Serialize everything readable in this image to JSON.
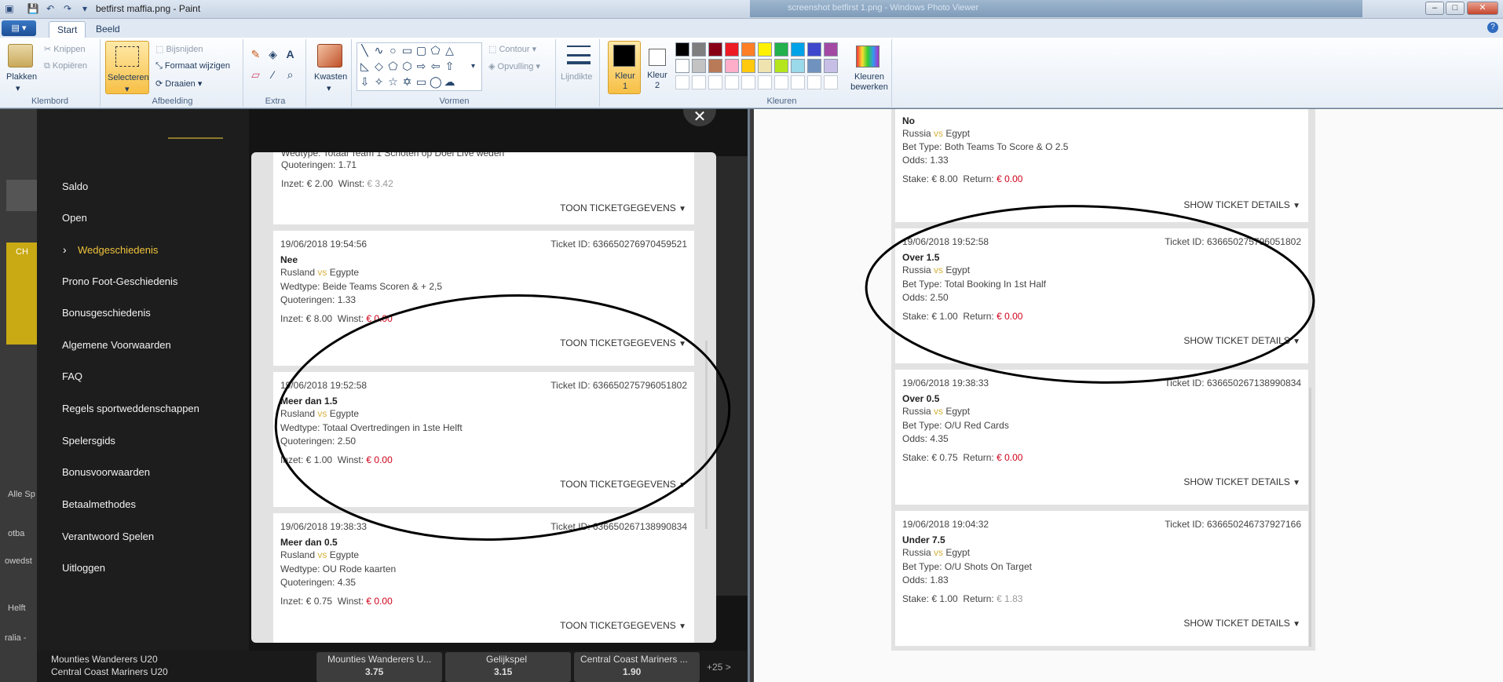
{
  "window": {
    "title": "betfirst maffia.png - Paint",
    "other_title": "screenshot betfirst 1.png - Windows Photo Viewer"
  },
  "ribbon": {
    "tabs": [
      "Start",
      "Beeld"
    ],
    "klembord": {
      "plakken": "Plakken",
      "knippen": "Knippen",
      "kopieren": "Kopiëren",
      "label": "Klembord"
    },
    "afbeelding": {
      "selecteren": "Selecteren",
      "bijsnijden": "Bijsnijden",
      "formaat": "Formaat wijzigen",
      "draaien": "Draaien",
      "label": "Afbeelding"
    },
    "extra": {
      "label": "Extra"
    },
    "kwasten": "Kwasten",
    "vormen": {
      "contour": "Contour",
      "opvulling": "Opvulling",
      "label": "Vormen"
    },
    "lijndikte": "Lijndikte",
    "kleur1": "Kleur 1",
    "kleur2": "Kleur 2",
    "kleuren": {
      "bewerken": "Kleuren bewerken",
      "label": "Kleuren"
    },
    "palette_row1": [
      "#000000",
      "#7f7f7f",
      "#880015",
      "#ed1c24",
      "#ff7f27",
      "#fff200",
      "#22b14c",
      "#00a2e8",
      "#3f48cc",
      "#a349a4"
    ],
    "palette_row2": [
      "#ffffff",
      "#c3c3c3",
      "#b97a57",
      "#ffaec9",
      "#ffc90e",
      "#efe4b0",
      "#b5e61d",
      "#99d9ea",
      "#7092be",
      "#c8bfe7"
    ]
  },
  "left_menu": {
    "items": [
      "Saldo",
      "Open",
      "Wedgeschiedenis",
      "Prono Foot-Geschiedenis",
      "Bonusgeschiedenis",
      "Algemene Voorwaarden",
      "FAQ",
      "Regels sportweddenschappen",
      "Spelersgids",
      "Bonusvoorwaarden",
      "Betaalmethodes",
      "Verantwoord Spelen",
      "Uitloggen"
    ],
    "active": "Wedgeschiedenis"
  },
  "left_tickets": {
    "partial": {
      "wedtype": "Wedtype: Totaal Team 1 Schoten op Doel Live weden",
      "odds": "Quoteringen: 1.71",
      "stake": "Inzet: € 2.00",
      "win_label": "Winst:",
      "win_value": "€ 3.42",
      "details": "TOON TICKETGEGEVENS"
    },
    "items": [
      {
        "date": "19/06/2018 19:54:56",
        "id": "Ticket ID: 636650276970459521",
        "selection": "Nee",
        "home": "Rusland",
        "vs": "vs",
        "away": "Egypte",
        "wedtype": "Wedtype: Beide Teams Scoren & + 2,5",
        "odds": "Quoteringen: 1.33",
        "stake": "Inzet: € 8.00",
        "win_label": "Winst:",
        "win_value": "€ 0.00",
        "details": "TOON TICKETGEGEVENS"
      },
      {
        "date": "19/06/2018 19:52:58",
        "id": "Ticket ID: 636650275796051802",
        "selection": "Meer dan 1.5",
        "home": "Rusland",
        "vs": "vs",
        "away": "Egypte",
        "wedtype": "Wedtype: Totaal Overtredingen in 1ste Helft",
        "odds": "Quoteringen: 2.50",
        "stake": "Inzet: € 1.00",
        "win_label": "Winst:",
        "win_value": "€ 0.00",
        "details": "TOON TICKETGEGEVENS"
      },
      {
        "date": "19/06/2018 19:38:33",
        "id": "Ticket ID: 636650267138990834",
        "selection": "Meer dan 0.5",
        "home": "Rusland",
        "vs": "vs",
        "away": "Egypte",
        "wedtype": "Wedtype: OU Rode kaarten",
        "odds": "Quoteringen: 4.35",
        "stake": "Inzet: € 0.75",
        "win_label": "Winst:",
        "win_value": "€ 0.00",
        "details": "TOON TICKETGEGEVENS"
      }
    ]
  },
  "left_background": {
    "bottom_row": [
      "Mounties Wanderers U20",
      "Central Coast Mariners U20",
      "Mounties Wanderers U...",
      "Gelijkspel",
      "Central Coast Mariners ..."
    ],
    "bottom_odds": [
      "3.75",
      "3.15",
      "1.90"
    ],
    "plus25": "+25 >",
    "stub_texts": [
      "CH",
      "Alle Sp",
      "Helft",
      "otba",
      "owedst",
      "ralia -"
    ]
  },
  "right_tickets": {
    "partial": {
      "selection": "No",
      "home": "Russia",
      "vs": "vs",
      "away": "Egypt",
      "bettype": "Bet Type: Both Teams To Score & O 2.5",
      "odds": "Odds: 1.33",
      "stake": "Stake: € 8.00",
      "return_label": "Return:",
      "return_value": "€ 0.00",
      "details": "SHOW TICKET DETAILS"
    },
    "items": [
      {
        "date": "19/06/2018 19:52:58",
        "id": "Ticket ID: 636650275796051802",
        "selection": "Over 1.5",
        "home": "Russia",
        "vs": "vs",
        "away": "Egypt",
        "bettype": "Bet Type: Total Booking In 1st Half",
        "odds": "Odds: 2.50",
        "stake": "Stake: € 1.00",
        "return_label": "Return:",
        "return_value": "€ 0.00",
        "details": "SHOW TICKET DETAILS"
      },
      {
        "date": "19/06/2018 19:38:33",
        "id": "Ticket ID: 636650267138990834",
        "selection": "Over 0.5",
        "home": "Russia",
        "vs": "vs",
        "away": "Egypt",
        "bettype": "Bet Type: O/U Red Cards",
        "odds": "Odds: 4.35",
        "stake": "Stake: € 0.75",
        "return_label": "Return:",
        "return_value": "€ 0.00",
        "details": "SHOW TICKET DETAILS"
      },
      {
        "date": "19/06/2018 19:04:32",
        "id": "Ticket ID: 636650246737927166",
        "selection": "Under 7.5",
        "home": "Russia",
        "vs": "vs",
        "away": "Egypt",
        "bettype": "Bet Type: O/U Shots On Target",
        "odds": "Odds: 1.83",
        "stake": "Stake: € 1.00",
        "return_label": "Return:",
        "return_value": "€ 1.83",
        "details": "SHOW TICKET DETAILS"
      }
    ]
  },
  "colors": {
    "accent_gold": "#f0c33c",
    "loss_red": "#d0021b",
    "win_gray": "#9a9a9a"
  }
}
